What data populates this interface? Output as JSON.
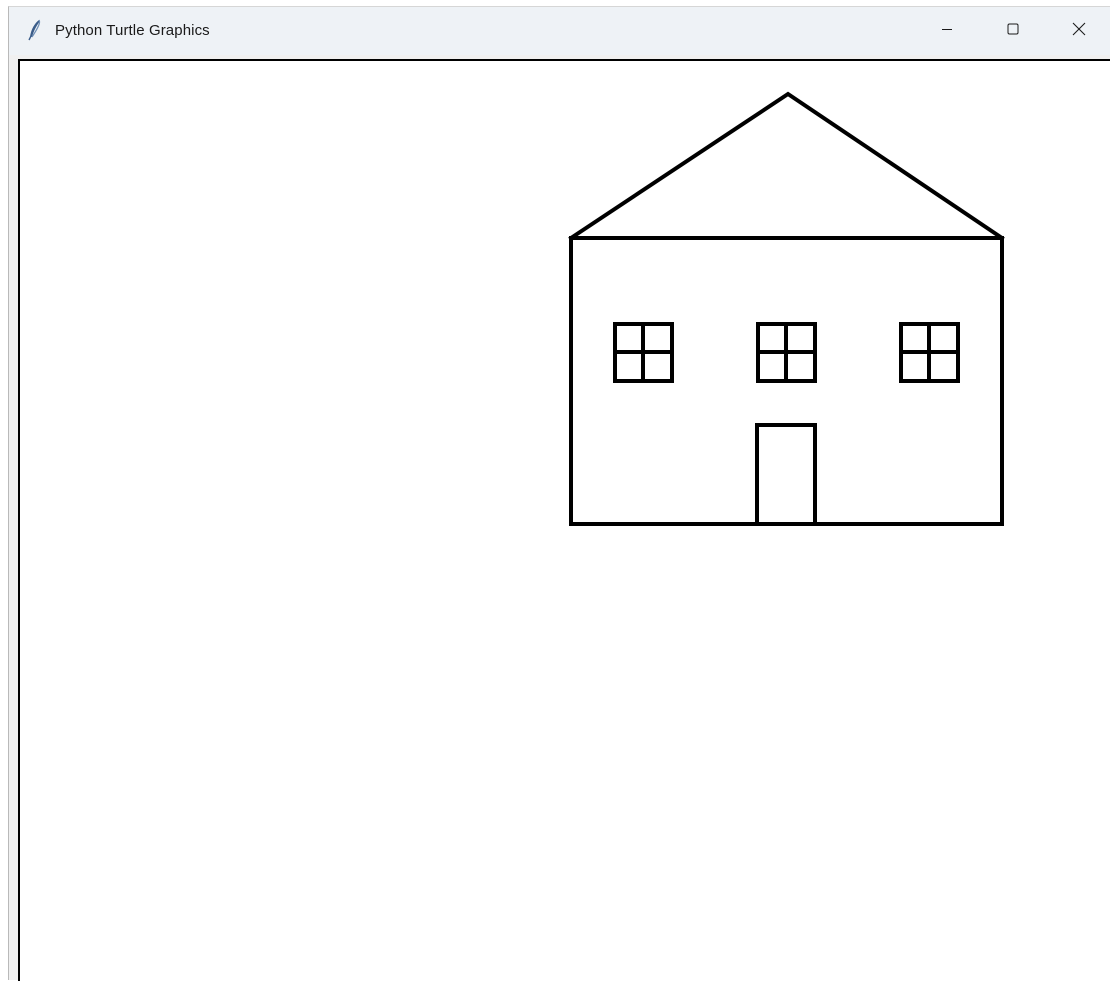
{
  "window": {
    "title": "Python Turtle Graphics",
    "icon": "feather-icon",
    "controls": {
      "minimize": "minimize-icon",
      "maximize": "maximize-icon",
      "close": "close-icon"
    }
  },
  "canvas": {
    "background": "#ffffff",
    "pen_color": "#000000",
    "drawing": "house"
  },
  "colors": {
    "titlebar": "#eef2f6",
    "title_text": "#1a1a1a",
    "canvas_border": "#000000"
  }
}
